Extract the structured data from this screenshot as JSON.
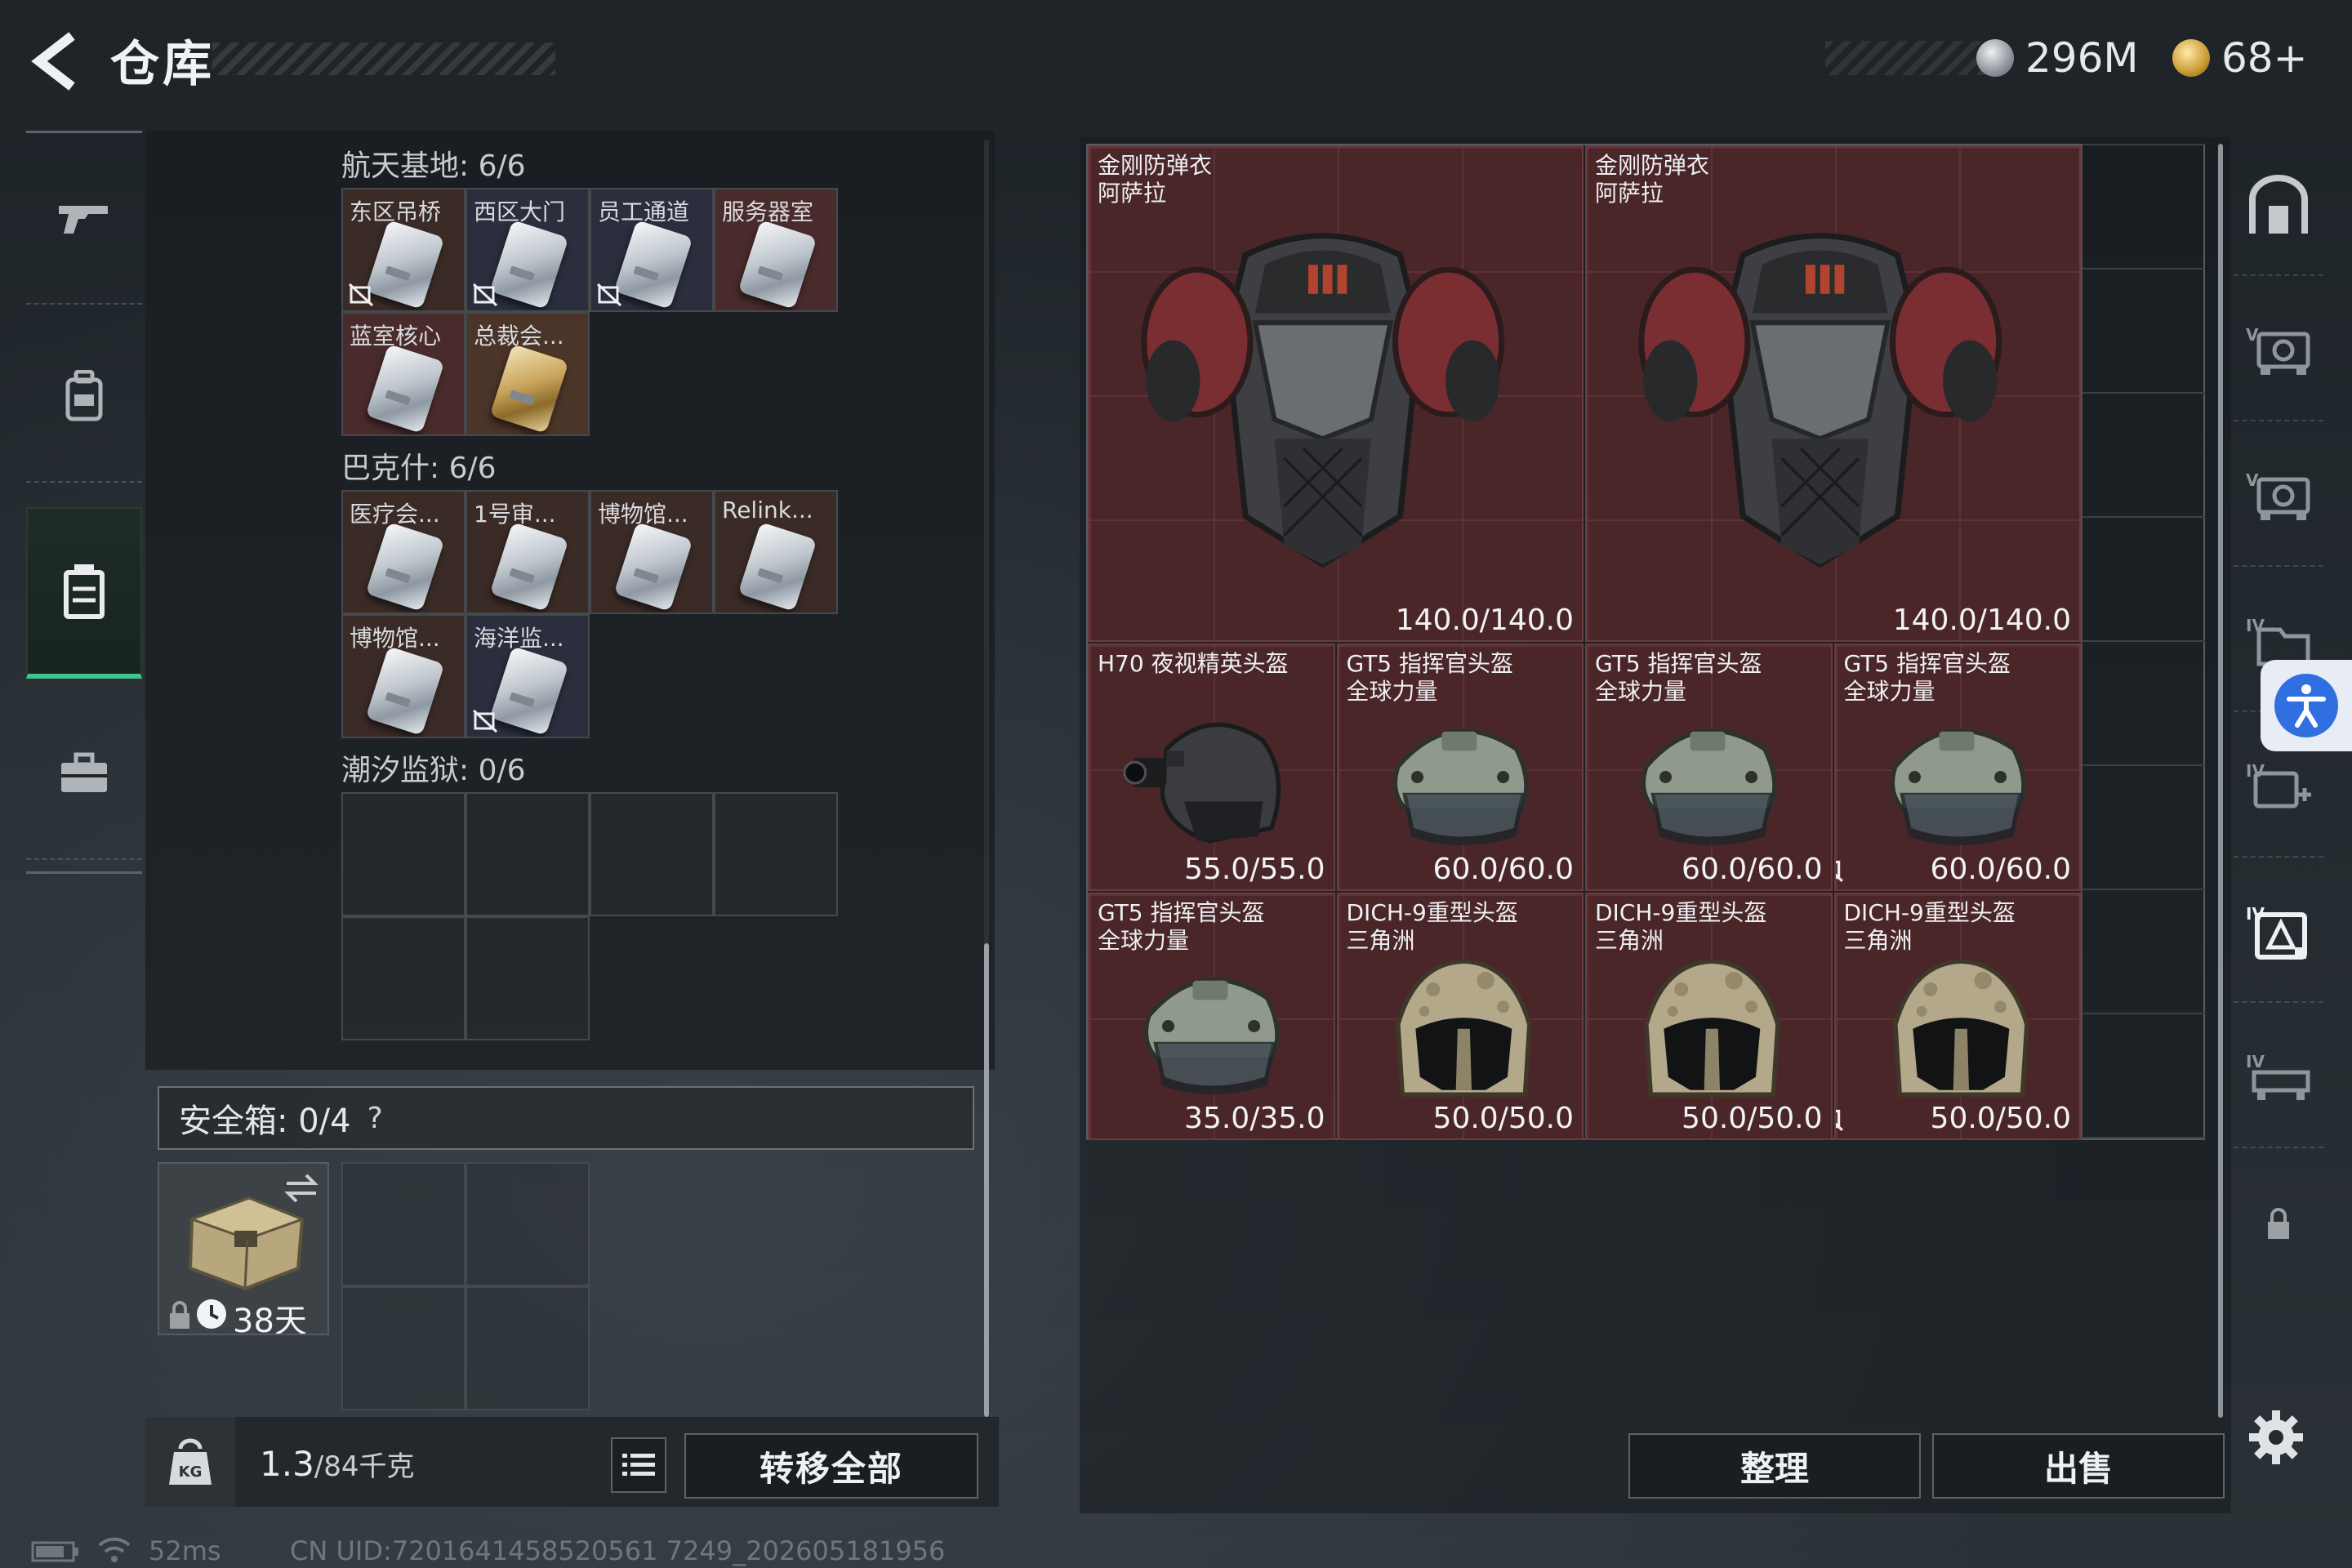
{
  "header": {
    "title": "仓库",
    "currency_silver": "296M",
    "currency_gold": "68+"
  },
  "left_nav": {
    "items": [
      {
        "icon": "gun-icon"
      },
      {
        "icon": "backpack-icon"
      },
      {
        "icon": "storage-icon",
        "active": true
      },
      {
        "icon": "briefcase-icon"
      }
    ]
  },
  "storage": {
    "sections": [
      {
        "title": "航天基地: 6/6",
        "cards": [
          {
            "label": "东区吊桥",
            "color": "brown",
            "bound": true
          },
          {
            "label": "西区大门",
            "color": "blue",
            "bound": true
          },
          {
            "label": "员工通道",
            "color": "blue",
            "bound": true
          },
          {
            "label": "服务器室",
            "color": "red",
            "bound": false
          },
          {
            "label": "蓝室核心",
            "color": "red",
            "bound": false
          },
          {
            "label": "总裁会...",
            "color": "gold",
            "bound": false
          }
        ]
      },
      {
        "title": "巴克什: 6/6",
        "cards": [
          {
            "label": "医疗会...",
            "color": "brown",
            "bound": false
          },
          {
            "label": "1号审...",
            "color": "brown",
            "bound": false
          },
          {
            "label": "博物馆...",
            "color": "brown",
            "bound": false
          },
          {
            "label": "Relink...",
            "color": "brown",
            "bound": false
          },
          {
            "label": "博物馆...",
            "color": "brown",
            "bound": false
          },
          {
            "label": "海洋监...",
            "color": "blue",
            "bound": true
          }
        ]
      },
      {
        "title": "潮汐监狱: 0/6",
        "cards": []
      }
    ],
    "safe_box_label": "安全箱: 0/4",
    "safe_box_help": "?",
    "safe_box_timer": "38天",
    "weight_value": "1.3",
    "weight_capacity": "/84千克",
    "transfer_all": "转移全部"
  },
  "inventory": {
    "items": [
      {
        "name": "金刚防弹衣\n阿萨拉",
        "durability": "140.0/140.0",
        "type": "armor",
        "bound": false
      },
      {
        "name": "金刚防弹衣\n阿萨拉",
        "durability": "140.0/140.0",
        "type": "armor",
        "bound": false
      },
      {
        "name": "H70 夜视精英头盔",
        "durability": "55.0/55.0",
        "type": "nv-helmet",
        "bound": false
      },
      {
        "name": "GT5 指挥官头盔\n全球力量",
        "durability": "60.0/60.0",
        "type": "gt5-helmet",
        "bound": false
      },
      {
        "name": "GT5 指挥官头盔\n全球力量",
        "durability": "60.0/60.0",
        "type": "gt5-helmet",
        "bound": false
      },
      {
        "name": "GT5 指挥官头盔\n全球力量",
        "durability": "60.0/60.0",
        "type": "gt5-helmet",
        "bound": true
      },
      {
        "name": "GT5 指挥官头盔\n全球力量",
        "durability": "35.0/35.0",
        "type": "gt5-helmet",
        "bound": false
      },
      {
        "name": "DICH-9重型头盔\n三角洲",
        "durability": "50.0/50.0",
        "type": "dich-helmet",
        "bound": false
      },
      {
        "name": "DICH-9重型头盔\n三角洲",
        "durability": "50.0/50.0",
        "type": "dich-helmet",
        "bound": false
      },
      {
        "name": "DICH-9重型头盔\n三角洲",
        "durability": "50.0/50.0",
        "type": "dich-helmet",
        "bound": true
      }
    ],
    "sort_label": "整理",
    "sell_label": "出售"
  },
  "side_tabs": [
    {
      "icon": "home-slot-icon"
    },
    {
      "icon": "storage-tab-1-icon"
    },
    {
      "icon": "storage-tab-2-icon"
    },
    {
      "icon": "storage-tab-3-icon"
    },
    {
      "icon": "storage-tab-add-icon"
    },
    {
      "icon": "storage-tab-active-icon",
      "active": true
    },
    {
      "icon": "storage-tab-4-icon"
    },
    {
      "icon": "lock-icon"
    }
  ],
  "status_bar": {
    "ping": "52ms",
    "uid": "CN UID:7201641458520561 7249_202605181956"
  },
  "colors": {
    "accent_green": "#3fc38a",
    "item_red_bg": "#4b2629",
    "accessibility_blue": "#2f6fe0"
  }
}
